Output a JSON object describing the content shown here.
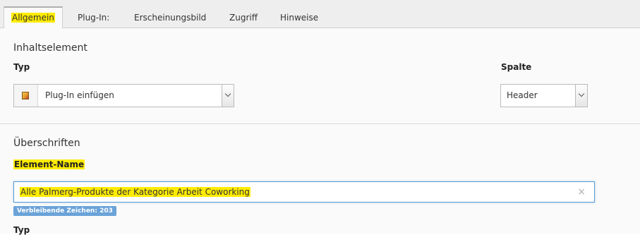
{
  "tabs": [
    {
      "label": "Allgemein",
      "active": true
    },
    {
      "label": "Plug-In:"
    },
    {
      "label": "Erscheinungsbild"
    },
    {
      "label": "Zugriff"
    },
    {
      "label": "Hinweise"
    }
  ],
  "section_content": {
    "title": "Inhaltselement",
    "typ_label": "Typ",
    "typ_value": "Plug-In einfügen",
    "typ_icon": "cube-icon",
    "spalte_label": "Spalte",
    "spalte_value": "Header"
  },
  "section_headings": {
    "title": "Überschriften",
    "element_name_label": "Element-Name",
    "element_name_value": "Alle Palmerg-Produkte der Kategorie Arbeit Coworking",
    "remaining_chars": "Verbleibende Zeichen: 203",
    "typ_label": "Typ"
  },
  "colors": {
    "highlight": "#ffec00",
    "input_focus": "#5b9bd5",
    "badge": "#6aa3d8"
  }
}
